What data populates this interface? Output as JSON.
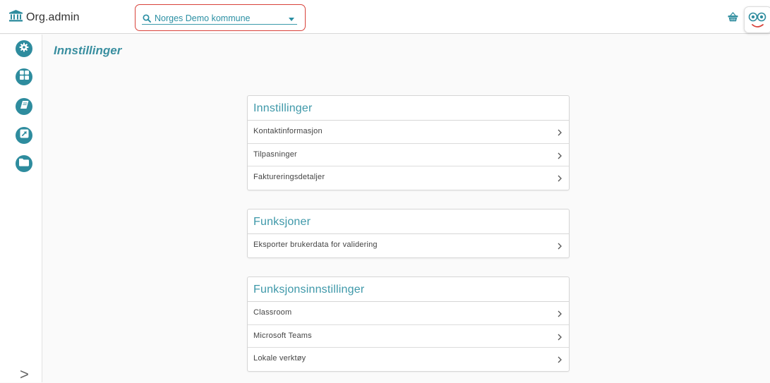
{
  "header": {
    "brand": "Org.admin",
    "org_selector_value": "Norges Demo kommune"
  },
  "sidebar": {
    "items": [
      {
        "icon": "gear-icon"
      },
      {
        "icon": "grid-icon"
      },
      {
        "icon": "book-icon"
      },
      {
        "icon": "external-link-icon"
      },
      {
        "icon": "folder-icon"
      }
    ],
    "expand_label": ">"
  },
  "page": {
    "title": "Innstillinger"
  },
  "sections": [
    {
      "title": "Innstillinger",
      "items": [
        "Kontaktinformasjon",
        "Tilpasninger",
        "Faktureringsdetaljer"
      ]
    },
    {
      "title": "Funksjoner",
      "items": [
        "Eksporter brukerdata for validering"
      ]
    },
    {
      "title": "Funksjonsinnstillinger",
      "items": [
        "Classroom",
        "Microsoft Teams",
        "Lokale verktøy"
      ]
    }
  ],
  "colors": {
    "accent": "#2e8c9e",
    "selector_border": "#d8423a"
  }
}
